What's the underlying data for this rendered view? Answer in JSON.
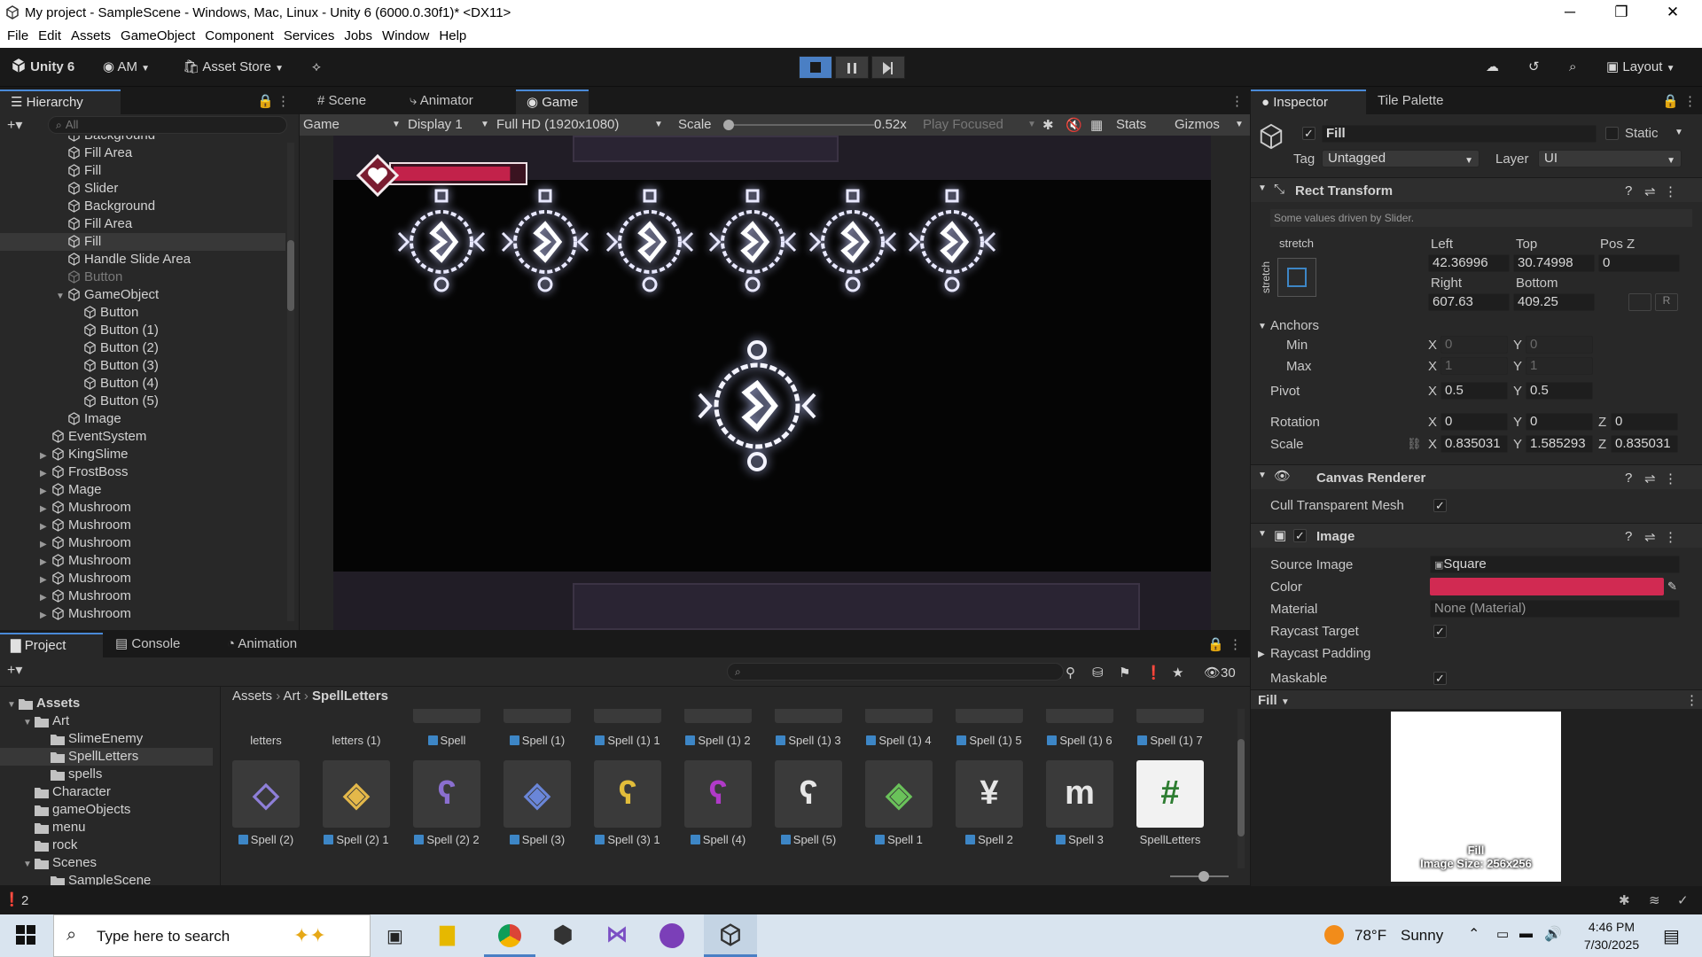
{
  "window": {
    "title": "My project - SampleScene - Windows, Mac, Linux - Unity 6 (6000.0.30f1)* <DX11>"
  },
  "menu": [
    "File",
    "Edit",
    "Assets",
    "GameObject",
    "Component",
    "Services",
    "Jobs",
    "Window",
    "Help"
  ],
  "toolbar": {
    "unity": "Unity 6",
    "account": "AM",
    "asset_store": "Asset Store",
    "layout": "Layout"
  },
  "hierarchy": {
    "tab": "Hierarchy",
    "search_placeholder": "All",
    "items": [
      {
        "label": "Background",
        "depth": 1,
        "state": "normal",
        "arrow": ""
      },
      {
        "label": "Fill Area",
        "depth": 1,
        "state": "normal",
        "arrow": ""
      },
      {
        "label": "Fill",
        "depth": 1,
        "state": "normal",
        "arrow": ""
      },
      {
        "label": "Slider",
        "depth": 1,
        "state": "normal",
        "arrow": ""
      },
      {
        "label": "Background",
        "depth": 1,
        "state": "normal",
        "arrow": ""
      },
      {
        "label": "Fill Area",
        "depth": 1,
        "state": "normal",
        "arrow": ""
      },
      {
        "label": "Fill",
        "depth": 1,
        "state": "selected",
        "arrow": ""
      },
      {
        "label": "Handle Slide Area",
        "depth": 1,
        "state": "normal",
        "arrow": ""
      },
      {
        "label": "Button",
        "depth": 1,
        "state": "dim",
        "arrow": ""
      },
      {
        "label": "GameObject",
        "depth": 1,
        "state": "normal",
        "arrow": "▼"
      },
      {
        "label": "Button",
        "depth": 2,
        "state": "normal",
        "arrow": ""
      },
      {
        "label": "Button (1)",
        "depth": 2,
        "state": "normal",
        "arrow": ""
      },
      {
        "label": "Button (2)",
        "depth": 2,
        "state": "normal",
        "arrow": ""
      },
      {
        "label": "Button (3)",
        "depth": 2,
        "state": "normal",
        "arrow": ""
      },
      {
        "label": "Button (4)",
        "depth": 2,
        "state": "normal",
        "arrow": ""
      },
      {
        "label": "Button (5)",
        "depth": 2,
        "state": "normal",
        "arrow": ""
      },
      {
        "label": "Image",
        "depth": 1,
        "state": "normal",
        "arrow": ""
      },
      {
        "label": "EventSystem",
        "depth": 0,
        "state": "normal",
        "arrow": ""
      },
      {
        "label": "KingSlime",
        "depth": 0,
        "state": "normal",
        "arrow": "▶"
      },
      {
        "label": "FrostBoss",
        "depth": 0,
        "state": "normal",
        "arrow": "▶"
      },
      {
        "label": "Mage",
        "depth": 0,
        "state": "normal",
        "arrow": "▶"
      },
      {
        "label": "Mushroom",
        "depth": 0,
        "state": "normal",
        "arrow": "▶"
      },
      {
        "label": "Mushroom",
        "depth": 0,
        "state": "normal",
        "arrow": "▶"
      },
      {
        "label": "Mushroom",
        "depth": 0,
        "state": "normal",
        "arrow": "▶"
      },
      {
        "label": "Mushroom",
        "depth": 0,
        "state": "normal",
        "arrow": "▶"
      },
      {
        "label": "Mushroom",
        "depth": 0,
        "state": "normal",
        "arrow": "▶"
      },
      {
        "label": "Mushroom",
        "depth": 0,
        "state": "normal",
        "arrow": "▶"
      },
      {
        "label": "Mushroom",
        "depth": 0,
        "state": "normal",
        "arrow": "▶"
      }
    ]
  },
  "game": {
    "tabs": [
      "Scene",
      "Animator",
      "Game"
    ],
    "mode": "Game",
    "display": "Display 1",
    "resolution": "Full HD (1920x1080)",
    "scale_label": "Scale",
    "scale_value": "0.52x",
    "play_focused": "Play Focused",
    "stats": "Stats",
    "gizmos": "Gizmos",
    "health_fill": 0.9
  },
  "inspector": {
    "tabs": [
      "Inspector",
      "Tile Palette"
    ],
    "object_name": "Fill",
    "static_label": "Static",
    "tag_label": "Tag",
    "tag_value": "Untagged",
    "layer_label": "Layer",
    "layer_value": "UI",
    "rect_transform": {
      "title": "Rect Transform",
      "note": "Some values driven by Slider.",
      "stretch": "stretch",
      "left_label": "Left",
      "left": "42.36996",
      "top_label": "Top",
      "top": "30.74998",
      "posz_label": "Pos Z",
      "posz": "0",
      "right_label": "Right",
      "right": "607.63",
      "bottom_label": "Bottom",
      "bottom": "409.25",
      "anchors": "Anchors",
      "min": "Min",
      "min_x": "0",
      "min_y": "0",
      "max": "Max",
      "max_x": "1",
      "max_y": "1",
      "pivot": "Pivot",
      "pivot_x": "0.5",
      "pivot_y": "0.5",
      "rotation": "Rotation",
      "rot_x": "0",
      "rot_y": "0",
      "rot_z": "0",
      "scale": "Scale",
      "scale_x": "0.835031",
      "scale_y": "1.585293",
      "scale_z": "0.835031"
    },
    "canvas_renderer": {
      "title": "Canvas Renderer",
      "cull": "Cull Transparent Mesh"
    },
    "image": {
      "title": "Image",
      "source_label": "Source Image",
      "source": "Square",
      "color_label": "Color",
      "color": "#d12a52",
      "material_label": "Material",
      "material": "None (Material)",
      "raycast_label": "Raycast Target",
      "padding_label": "Raycast Padding",
      "maskable_label": "Maskable"
    },
    "preview": {
      "dropdown": "Fill",
      "name": "Fill",
      "size": "Image Size: 256x256"
    }
  },
  "project": {
    "tabs": [
      "Project",
      "Console",
      "Animation"
    ],
    "count": "30",
    "breadcrumb": [
      "Assets",
      "Art",
      "SpellLetters"
    ],
    "tree": [
      {
        "label": "Assets",
        "depth": 0,
        "arrow": "▼",
        "bold": true
      },
      {
        "label": "Art",
        "depth": 1,
        "arrow": "▼"
      },
      {
        "label": "SlimeEnemy",
        "depth": 2,
        "arrow": ""
      },
      {
        "label": "SpellLetters",
        "depth": 2,
        "arrow": "",
        "selected": true
      },
      {
        "label": "spells",
        "depth": 2,
        "arrow": ""
      },
      {
        "label": "Character",
        "depth": 1,
        "arrow": ""
      },
      {
        "label": "gameObjects",
        "depth": 1,
        "arrow": ""
      },
      {
        "label": "menu",
        "depth": 1,
        "arrow": ""
      },
      {
        "label": "rock",
        "depth": 1,
        "arrow": ""
      },
      {
        "label": "Scenes",
        "depth": 1,
        "arrow": "▼"
      },
      {
        "label": "SampleScene",
        "depth": 2,
        "arrow": ""
      }
    ],
    "row1": [
      "letters",
      "letters (1)",
      "Spell",
      "Spell (1)",
      "Spell (1) 1",
      "Spell (1) 2",
      "Spell (1) 3",
      "Spell (1) 4",
      "Spell (1) 5",
      "Spell (1) 6",
      "Spell (1) 7"
    ],
    "row2": [
      {
        "label": "Spell (2)",
        "glyph": "◇",
        "color": "#8e7fd8"
      },
      {
        "label": "Spell (2) 1",
        "glyph": "◈",
        "color": "#e4b84a"
      },
      {
        "label": "Spell (2) 2",
        "glyph": "ʕ",
        "color": "#8a6fd0"
      },
      {
        "label": "Spell (3)",
        "glyph": "◈",
        "color": "#6a86d8"
      },
      {
        "label": "Spell (3) 1",
        "glyph": "ʕ",
        "color": "#e2bd3a"
      },
      {
        "label": "Spell (4)",
        "glyph": "ʕ",
        "color": "#b03ac8"
      },
      {
        "label": "Spell (5)",
        "glyph": "ʕ",
        "color": "#e6e6e6"
      },
      {
        "label": "Spell 1",
        "glyph": "◈",
        "color": "#6ac25a"
      },
      {
        "label": "Spell 2",
        "glyph": "¥",
        "color": "#e6e6e6"
      },
      {
        "label": "Spell 3",
        "glyph": "m",
        "color": "#e6e6e6"
      },
      {
        "label": "SpellLetters",
        "glyph": "#",
        "color": "#2e7d32"
      }
    ]
  },
  "status": {
    "count": "2"
  },
  "taskbar": {
    "search_placeholder": "Type here to search",
    "temp": "78°F",
    "weather": "Sunny",
    "time": "4:46 PM",
    "date": "7/30/2025"
  }
}
